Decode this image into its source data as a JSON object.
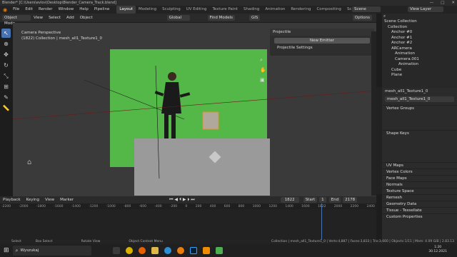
{
  "window": {
    "title": "Blender* [C:\\Users\\evlov\\Desktop\\Blender_Camera_Track.blend]",
    "controls": [
      "—",
      "□",
      "✕"
    ]
  },
  "menu": {
    "items": [
      "File",
      "Edit",
      "Render",
      "Window",
      "Help",
      "Pipeline"
    ],
    "workspaces": [
      "Layout",
      "Modeling",
      "Sculpting",
      "UV Editing",
      "Texture Paint",
      "Shading",
      "Animation",
      "Rendering",
      "Compositing",
      "Scripting"
    ],
    "active_workspace": "Layout",
    "scene_label": "Scene",
    "view_layer_label": "View Layer"
  },
  "view_header": {
    "mode": "Object Mode",
    "menus": [
      "View",
      "Select",
      "Add",
      "Object"
    ],
    "orientation": "Global",
    "find_models": "Find Models",
    "gis": "GIS",
    "options": "Options"
  },
  "viewport": {
    "camera_label": "Camera Perspective",
    "collection_label": "(1822) Collection | mesh_all1_Texture1_0"
  },
  "npanel": {
    "title": "Projectile",
    "new_emitter": "New Emitter",
    "settings": "Projectile Settings"
  },
  "outliner": {
    "search_placeholder": "",
    "rows": [
      {
        "indent": 0,
        "label": "Scene Collection"
      },
      {
        "indent": 1,
        "label": "Collection"
      },
      {
        "indent": 2,
        "label": "Anchor #0"
      },
      {
        "indent": 2,
        "label": "Anchor #1"
      },
      {
        "indent": 2,
        "label": "Anchor #2"
      },
      {
        "indent": 2,
        "label": "ARCamera"
      },
      {
        "indent": 3,
        "label": "Animation"
      },
      {
        "indent": 3,
        "label": "Camera.001"
      },
      {
        "indent": 4,
        "label": "Animation"
      },
      {
        "indent": 2,
        "label": "Cube"
      },
      {
        "indent": 2,
        "label": "Plane"
      }
    ]
  },
  "properties": {
    "object_name": "mesh_all1_Texture1_0",
    "mesh_name": "mesh_all1_Texture1_0",
    "sections": [
      "Vertex Groups",
      "Shape Keys",
      "UV Maps",
      "Vertex Colors",
      "Face Maps",
      "Normals",
      "Texture Space",
      "Remesh",
      "Geometry Data",
      "Tissue - Tessellate",
      "Custom Properties"
    ]
  },
  "timeline": {
    "menus": [
      "Playback",
      "Keying",
      "View",
      "Marker"
    ],
    "current_frame": "1822",
    "start_label": "Start",
    "start_value": "1",
    "end_label": "End",
    "end_value": "2178",
    "ruler_ticks": [
      "-2200",
      "-2000",
      "-1800",
      "-1600",
      "-1400",
      "-1200",
      "-1000",
      "-800",
      "-600",
      "-400",
      "-200",
      "0",
      "200",
      "400",
      "600",
      "800",
      "1000",
      "1200",
      "1400",
      "1600",
      "1822",
      "2000",
      "2200",
      "2400"
    ]
  },
  "status": {
    "left": "Select",
    "box_select": "Box Select",
    "rotate": "Rotate View",
    "context": "Object Context Menu",
    "stats": "Collection | mesh_all1_Texture1_0 | Verts:4,887 | Faces:3,833 | Tris:3,660 | Objects:1/11 | Mem: 4.09 GiB | 2.83.13"
  },
  "taskbar": {
    "search_placeholder": "Wyszukaj",
    "clock_time": "1:20",
    "clock_date": "30.12.2021"
  }
}
